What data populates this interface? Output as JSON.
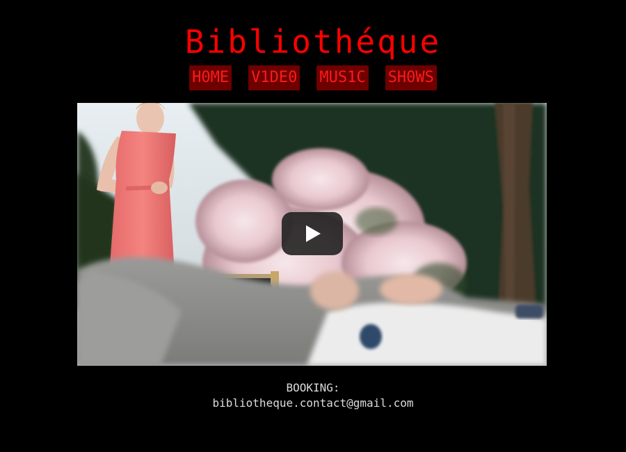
{
  "header": {
    "title": "Bibliothéque"
  },
  "nav": {
    "items": [
      {
        "label": "H0ME"
      },
      {
        "label": "V1DE0"
      },
      {
        "label": "MUS1C"
      },
      {
        "label": "SH0WS"
      }
    ]
  },
  "video": {
    "play_icon": "play-icon"
  },
  "footer": {
    "booking_label": "BOOKING:",
    "email": "bibliotheque.contact@gmail.com"
  },
  "colors": {
    "background": "#000000",
    "title": "#ff0000",
    "nav_bg": "#6e0000",
    "nav_text": "#ff1a1a",
    "footer_text": "#dcdcdc"
  }
}
